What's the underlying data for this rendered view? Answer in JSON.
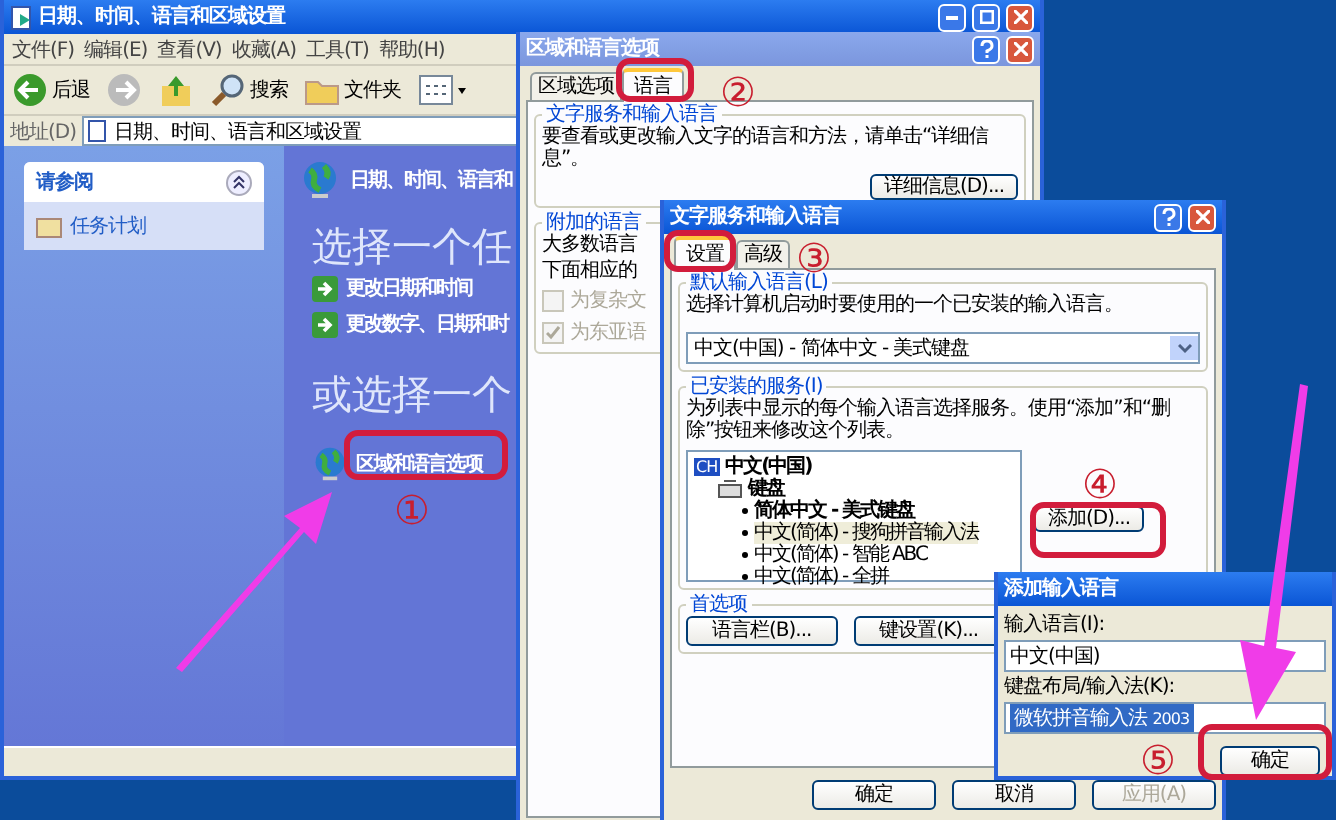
{
  "explorer": {
    "title": "日期、时间、语言和区域设置",
    "menu": [
      "文件(F)",
      "编辑(E)",
      "查看(V)",
      "收藏(A)",
      "工具(T)",
      "帮助(H)"
    ],
    "toolbar": {
      "back": "后退",
      "search": "搜索",
      "folders": "文件夹"
    },
    "address": {
      "label": "地址(D)",
      "value": "日期、时间、语言和区域设置"
    },
    "see_also": {
      "title": "请参阅",
      "expanded": true,
      "items": [
        "任务计划"
      ]
    },
    "header": "日期、时间、语言和",
    "pick_task": "选择一个任",
    "tasks": [
      "更改日期和时间",
      "更改数字、日期和时"
    ],
    "pick_icon": "或选择一个",
    "icon_link": "区域和语言选项"
  },
  "regional_dialog": {
    "title": "区域和语言选项",
    "tabs": [
      {
        "label": "区域选项",
        "selected": false
      },
      {
        "label": "语言",
        "selected": true
      }
    ],
    "text_services": {
      "title": "文字服务和输入语言",
      "text": "要查看或更改输入文字的语言和方法，请单击“详细信息”。",
      "button": "详细信息(D)..."
    },
    "supplemental": {
      "title": "附加的语言",
      "lines": [
        "大多数语言",
        "下面相应的"
      ],
      "checkboxes": [
        {
          "label": "为复杂文",
          "checked": false,
          "disabled": true
        },
        {
          "label": "为东亚语",
          "checked": true,
          "disabled": true
        }
      ]
    }
  },
  "text_services_dialog": {
    "title": "文字服务和输入语言",
    "tabs": [
      {
        "label": "设置",
        "selected": true
      },
      {
        "label": "高级",
        "selected": false
      }
    ],
    "default_language": {
      "title": "默认输入语言(L)",
      "text": "选择计算机启动时要使用的一个已安装的输入语言。",
      "value": "中文(中国) - 简体中文 - 美式键盘"
    },
    "installed": {
      "title": "已安装的服务(I)",
      "text": "为列表中显示的每个输入语言选择服务。使用“添加”和“删除”按钮来修改这个列表。",
      "tree": [
        {
          "badge": "CH",
          "label": "中文(中国)",
          "children": [
            {
              "label": "键盘",
              "children": [
                {
                  "label": "简体中文 - 美式键盘",
                  "default": true,
                  "selected": false
                },
                {
                  "label": "中文(简体) - 搜狗拼音输入法",
                  "default": false,
                  "selected": true
                },
                {
                  "label": "中文(简体) - 智能 ABC",
                  "default": false,
                  "selected": false
                },
                {
                  "label": "中文(简体) - 全拼",
                  "default": false,
                  "selected": false
                }
              ]
            }
          ]
        }
      ],
      "add_button": "添加(D)..."
    },
    "preferences": {
      "title": "首选项",
      "buttons": [
        "语言栏(B)...",
        "键设置(K)..."
      ]
    },
    "buttons": [
      {
        "label": "确定",
        "disabled": false
      },
      {
        "label": "取消",
        "disabled": false
      },
      {
        "label": "应用(A)",
        "disabled": true
      }
    ]
  },
  "add_dialog": {
    "title": "添加输入语言",
    "language_label": "输入语言(I):",
    "language_value": "中文(中国)",
    "layout_label": "键盘布局/输入法(K):",
    "layout_value": "微软拼音输入法",
    "layout_version": "2003",
    "ok": "确定"
  },
  "annotations": [
    "①",
    "②",
    "③",
    "④",
    "⑤"
  ]
}
